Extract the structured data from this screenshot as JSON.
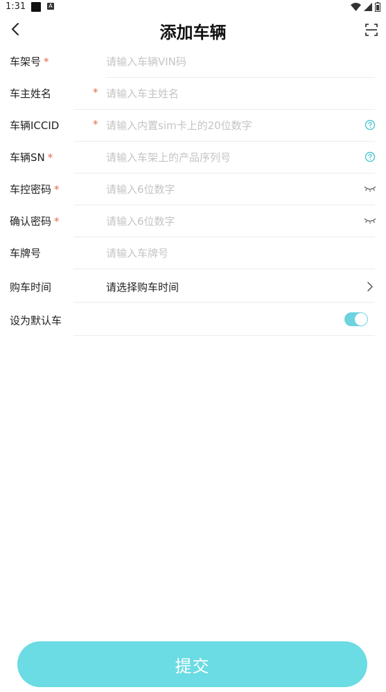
{
  "status_bar": {
    "time": "1:31",
    "a_badge": "A"
  },
  "header": {
    "title": "添加车辆",
    "back_icon": "chevron-left-icon",
    "scan_icon": "scan-icon"
  },
  "form": {
    "fields": [
      {
        "label": "车架号",
        "required": "*",
        "placeholder": "请输入车辆VIN码"
      },
      {
        "label": "车主姓名",
        "required": "*",
        "placeholder": "请输入车主姓名"
      },
      {
        "label": "车辆ICCID",
        "required": "*",
        "placeholder": "请输入内置sim卡上的20位数字",
        "icon": "help-circle-icon"
      },
      {
        "label": "车辆SN",
        "required": "*",
        "placeholder": "请输入车架上的产品序列号",
        "icon": "help-circle-icon"
      },
      {
        "label": "车控密码",
        "required": "*",
        "placeholder": "请输入6位数字",
        "icon": "eye-closed-icon"
      },
      {
        "label": "确认密码",
        "required": "*",
        "placeholder": "请输入6位数字",
        "icon": "eye-closed-icon"
      },
      {
        "label": "车牌号",
        "placeholder": "请输入车牌号"
      },
      {
        "label": "购车时间",
        "value": "请选择购车时间",
        "icon": "chevron-right-icon"
      },
      {
        "label": "设为默认车",
        "toggle_on": true
      }
    ]
  },
  "submit": {
    "label": "提交"
  },
  "colors": {
    "accent": "#6bdbe4",
    "required": "#e8684a",
    "placeholder": "#c4c4c4",
    "help_icon": "#4fc6d6"
  }
}
